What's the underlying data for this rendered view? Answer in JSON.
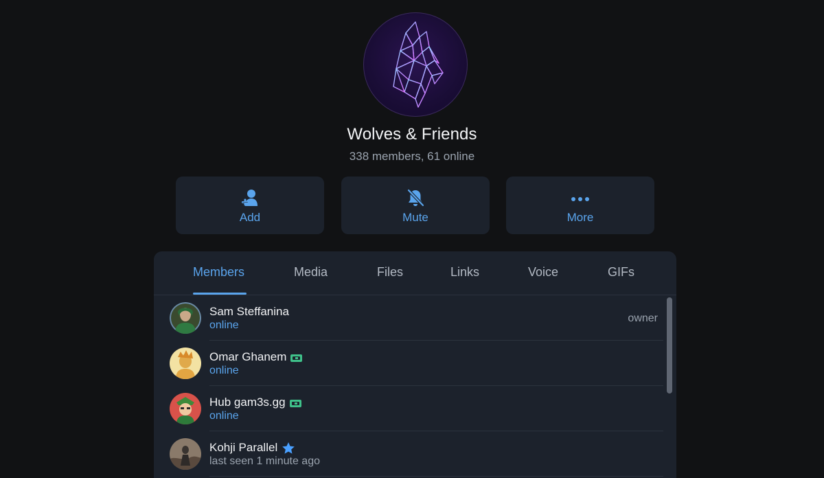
{
  "group": {
    "title": "Wolves & Friends",
    "subtitle": "338 members, 61 online",
    "avatar_icon": "geometric-wolf-logo"
  },
  "actions": [
    {
      "label": "Add",
      "icon": "add-user-icon"
    },
    {
      "label": "Mute",
      "icon": "bell-off-icon"
    },
    {
      "label": "More",
      "icon": "more-dots-icon"
    }
  ],
  "tabs": [
    {
      "label": "Members",
      "active": true
    },
    {
      "label": "Media"
    },
    {
      "label": "Files"
    },
    {
      "label": "Links"
    },
    {
      "label": "Voice"
    },
    {
      "label": "GIFs"
    }
  ],
  "members": [
    {
      "name": "Sam Steffanina",
      "status": "online",
      "role": "owner"
    },
    {
      "name": "Omar Ghanem",
      "status": "online",
      "badge": "tag-icon"
    },
    {
      "name": "Hub gam3s.gg",
      "status": "online",
      "badge": "tag-icon"
    },
    {
      "name": "Kohji Parallel",
      "status": "last seen 1 minute ago",
      "badge": "star-icon"
    }
  ],
  "colors": {
    "accent": "#5aa4ec",
    "background": "#111214",
    "panel": "#1c222c",
    "muted_text": "#9aa3ae",
    "tag_badge": "#3fc18a"
  }
}
